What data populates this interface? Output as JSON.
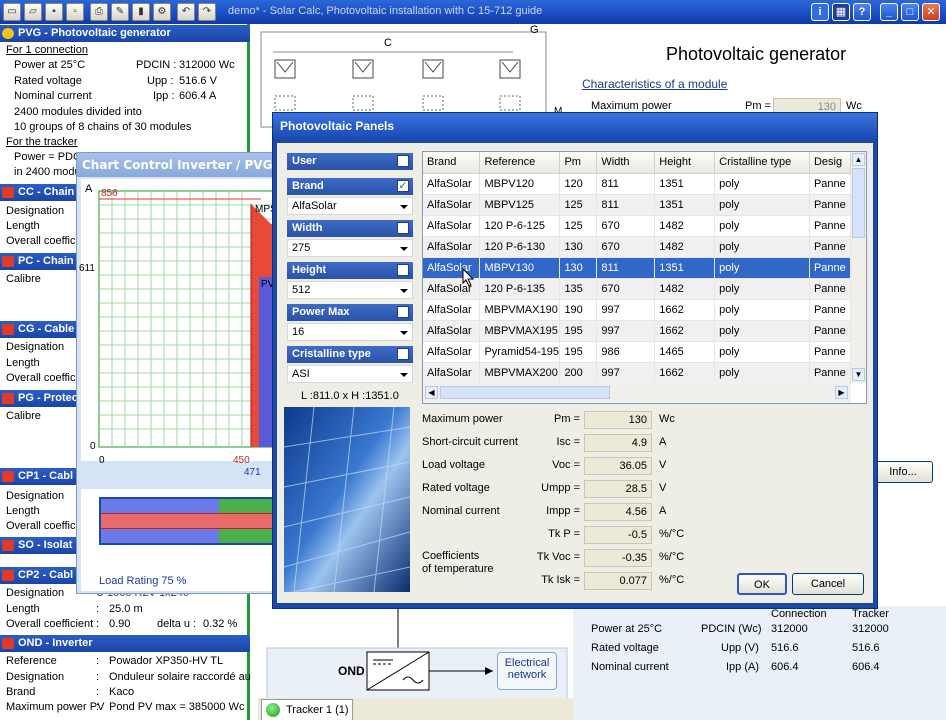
{
  "app": {
    "title": "demo* - Solar Calc, Photovoltaic installation with C 15-712 guide"
  },
  "left": {
    "pvg": {
      "title": "PVG - Photovoltaic generator",
      "connection_heading": "For 1 connection",
      "power_label": "Power at 25°C",
      "pdcin_label": "PDCIN :",
      "pdcin_value": "312000 Wc",
      "rated_voltage_label": "Rated voltage",
      "upp_label": "Upp :",
      "upp_value": "516.6 V",
      "nominal_current_label": "Nominal current",
      "ipp_label": "Ipp :",
      "ipp_value": "606.4 A",
      "modules_line": "2400 modules divided into",
      "groups_line": "10 groups of 8 chains of 30 modules",
      "tracker_heading": "For the tracker",
      "tracker_power": "Power = PDC",
      "tracker_modules": "in 2400 modu"
    },
    "cc": {
      "title": "CC - Chain",
      "designation": "Designation",
      "length": "Length",
      "overall": "Overall coeffici"
    },
    "pc": {
      "title": "PC - Chain",
      "calibre": "Calibre"
    },
    "cg": {
      "title": "CG - Cable",
      "designation": "Designation",
      "length": "Length",
      "overall": "Overall coeffic"
    },
    "pg": {
      "title": "PG - Protec",
      "calibre": "Calibre"
    },
    "cp1": {
      "title": "CP1 - Cabl",
      "designation": "Designation",
      "length": "Length",
      "overall": "Overall coeffic"
    },
    "so": {
      "title": "SO - Isolat"
    },
    "cp2": {
      "title": "CP2 - Cabl",
      "designation": "Designation",
      "designation_value": "U 1000 R2V 1x240",
      "length": "Length",
      "length_value": "25.0 m",
      "overall": "Overall coefficient",
      "overall_value": "0.90",
      "delta_label": "delta u :",
      "delta_value": "0.32 %"
    },
    "ond": {
      "title": "OND - Inverter",
      "reference": "Reference",
      "reference_value": "Powador XP350-HV TL",
      "designation": "Designation",
      "designation_value": "Onduleur solaire raccordé au re",
      "brand": "Brand",
      "brand_value": "Kaco",
      "maxpower": "Maximum power PV",
      "maxpower_value": "Pond PV max = 385000 Wc"
    }
  },
  "chart": {
    "title": "Chart Control Inverter / PVG",
    "y_unit": "A",
    "y_top": "856",
    "y_mid": "611",
    "y_zero": "0",
    "x_zero": "0",
    "x_450": "450",
    "x_471": "471",
    "label_mpp": "MPS",
    "label_pv": "PV",
    "load_rating": "Load Rating 75 %"
  },
  "diagram": {
    "label_c": "C",
    "label_g": "G",
    "label_m": "M",
    "ond": "OND",
    "electrical_network": "Electrical network",
    "tab_label": "Tracker 1 (1)"
  },
  "right": {
    "title": "Photovoltaic generator",
    "characteristics": "Characteristics of a module",
    "maxpower": "Maximum power",
    "pm_label": "Pm =",
    "pm_value": "130",
    "pm_unit": "Wc",
    "info_button": "Info...",
    "col_connection": "Connection",
    "col_tracker": "Tracker",
    "rows": [
      {
        "label": "Power at 25°C",
        "sym": "PDCIN (Wc)",
        "conn": "312000",
        "track": "312000"
      },
      {
        "label": "Rated voltage",
        "sym": "Upp (V)",
        "conn": "516.6",
        "track": "516.6"
      },
      {
        "label": "Nominal current",
        "sym": "Ipp (A)",
        "conn": "606.4",
        "track": "606.4"
      }
    ]
  },
  "dialog": {
    "title": "Photovoltaic Panels",
    "filters": [
      {
        "label": "User",
        "checked": false,
        "value": ""
      },
      {
        "label": "Brand",
        "checked": true,
        "value": "AlfaSolar"
      },
      {
        "label": "Width",
        "checked": false,
        "value": "275"
      },
      {
        "label": "Height",
        "checked": false,
        "value": "512"
      },
      {
        "label": "Power Max",
        "checked": false,
        "value": "16"
      },
      {
        "label": "Cristalline type",
        "checked": false,
        "value": "ASI"
      }
    ],
    "dims": "L :811.0 x H :1351.0",
    "columns": [
      "Brand",
      "Reference",
      "Pm",
      "Width",
      "Height",
      "Cristalline type",
      "Desig"
    ],
    "rows": [
      [
        "AlfaSolar",
        "MBPV120",
        "120",
        "811",
        "1351",
        "poly",
        "Panne"
      ],
      [
        "AlfaSolar",
        "MBPV125",
        "125",
        "811",
        "1351",
        "poly",
        "Panne"
      ],
      [
        "AlfaSolar",
        "120 P-6-125",
        "125",
        "670",
        "1482",
        "poly",
        "Panne"
      ],
      [
        "AlfaSolar",
        "120 P-6-130",
        "130",
        "670",
        "1482",
        "poly",
        "Panne"
      ],
      [
        "AlfaSolar",
        "MBPV130",
        "130",
        "811",
        "1351",
        "poly",
        "Panne"
      ],
      [
        "AlfaSolar",
        "120 P-6-135",
        "135",
        "670",
        "1482",
        "poly",
        "Panne"
      ],
      [
        "AlfaSolar",
        "MBPVMAX190",
        "190",
        "997",
        "1662",
        "poly",
        "Panne"
      ],
      [
        "AlfaSolar",
        "MBPVMAX195",
        "195",
        "997",
        "1662",
        "poly",
        "Panne"
      ],
      [
        "AlfaSolar",
        "Pyramid54-195",
        "195",
        "986",
        "1465",
        "poly",
        "Panne"
      ],
      [
        "AlfaSolar",
        "MBPVMAX200",
        "200",
        "997",
        "1662",
        "poly",
        "Panne"
      ]
    ],
    "selected_row": 4,
    "params": [
      {
        "label": "Maximum power",
        "sym": "Pm =",
        "value": "130",
        "unit": "Wc"
      },
      {
        "label": "Short-circuit current",
        "sym": "Isc =",
        "value": "4.9",
        "unit": "A"
      },
      {
        "label": "Load voltage",
        "sym": "Voc =",
        "value": "36.05",
        "unit": "V"
      },
      {
        "label": "Rated voltage",
        "sym": "Umpp =",
        "value": "28.5",
        "unit": "V"
      },
      {
        "label": "Nominal current",
        "sym": "Impp =",
        "value": "4.56",
        "unit": "A"
      },
      {
        "label": "",
        "sym": "Tk P =",
        "value": "-0.5",
        "unit": "%/°C"
      },
      {
        "label": "",
        "sym": "Tk Voc =",
        "value": "-0.35",
        "unit": "%/°C"
      },
      {
        "label": "",
        "sym": "Tk Isk =",
        "value": "0.077",
        "unit": "%/°C"
      }
    ],
    "coef_label_1": "Coefficients",
    "coef_label_2": "of temperature",
    "ok": "OK",
    "cancel": "Cancel"
  }
}
